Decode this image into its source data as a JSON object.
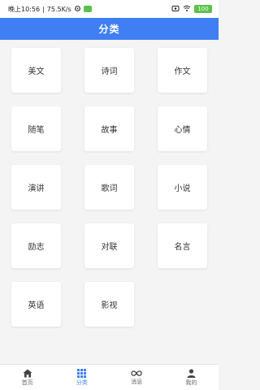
{
  "status": {
    "time": "晚上10:56",
    "speed": "75.5K/s",
    "battery": "100"
  },
  "header": {
    "title": "分类"
  },
  "categories": [
    {
      "label": "美文"
    },
    {
      "label": "诗词"
    },
    {
      "label": "作文"
    },
    {
      "label": "随笔"
    },
    {
      "label": "故事"
    },
    {
      "label": "心情"
    },
    {
      "label": "演讲"
    },
    {
      "label": "歌词"
    },
    {
      "label": "小说"
    },
    {
      "label": "励志"
    },
    {
      "label": "对联"
    },
    {
      "label": "名言"
    },
    {
      "label": "英语"
    },
    {
      "label": "影视"
    }
  ],
  "nav": {
    "items": [
      {
        "label": "首页",
        "icon": "home-icon"
      },
      {
        "label": "分类",
        "icon": "grid-icon",
        "active": true
      },
      {
        "label": "消息",
        "icon": "infinity-icon"
      },
      {
        "label": "我的",
        "icon": "user-icon"
      }
    ]
  },
  "colors": {
    "accent": "#3f7ff3",
    "background": "#f4f4f4"
  }
}
